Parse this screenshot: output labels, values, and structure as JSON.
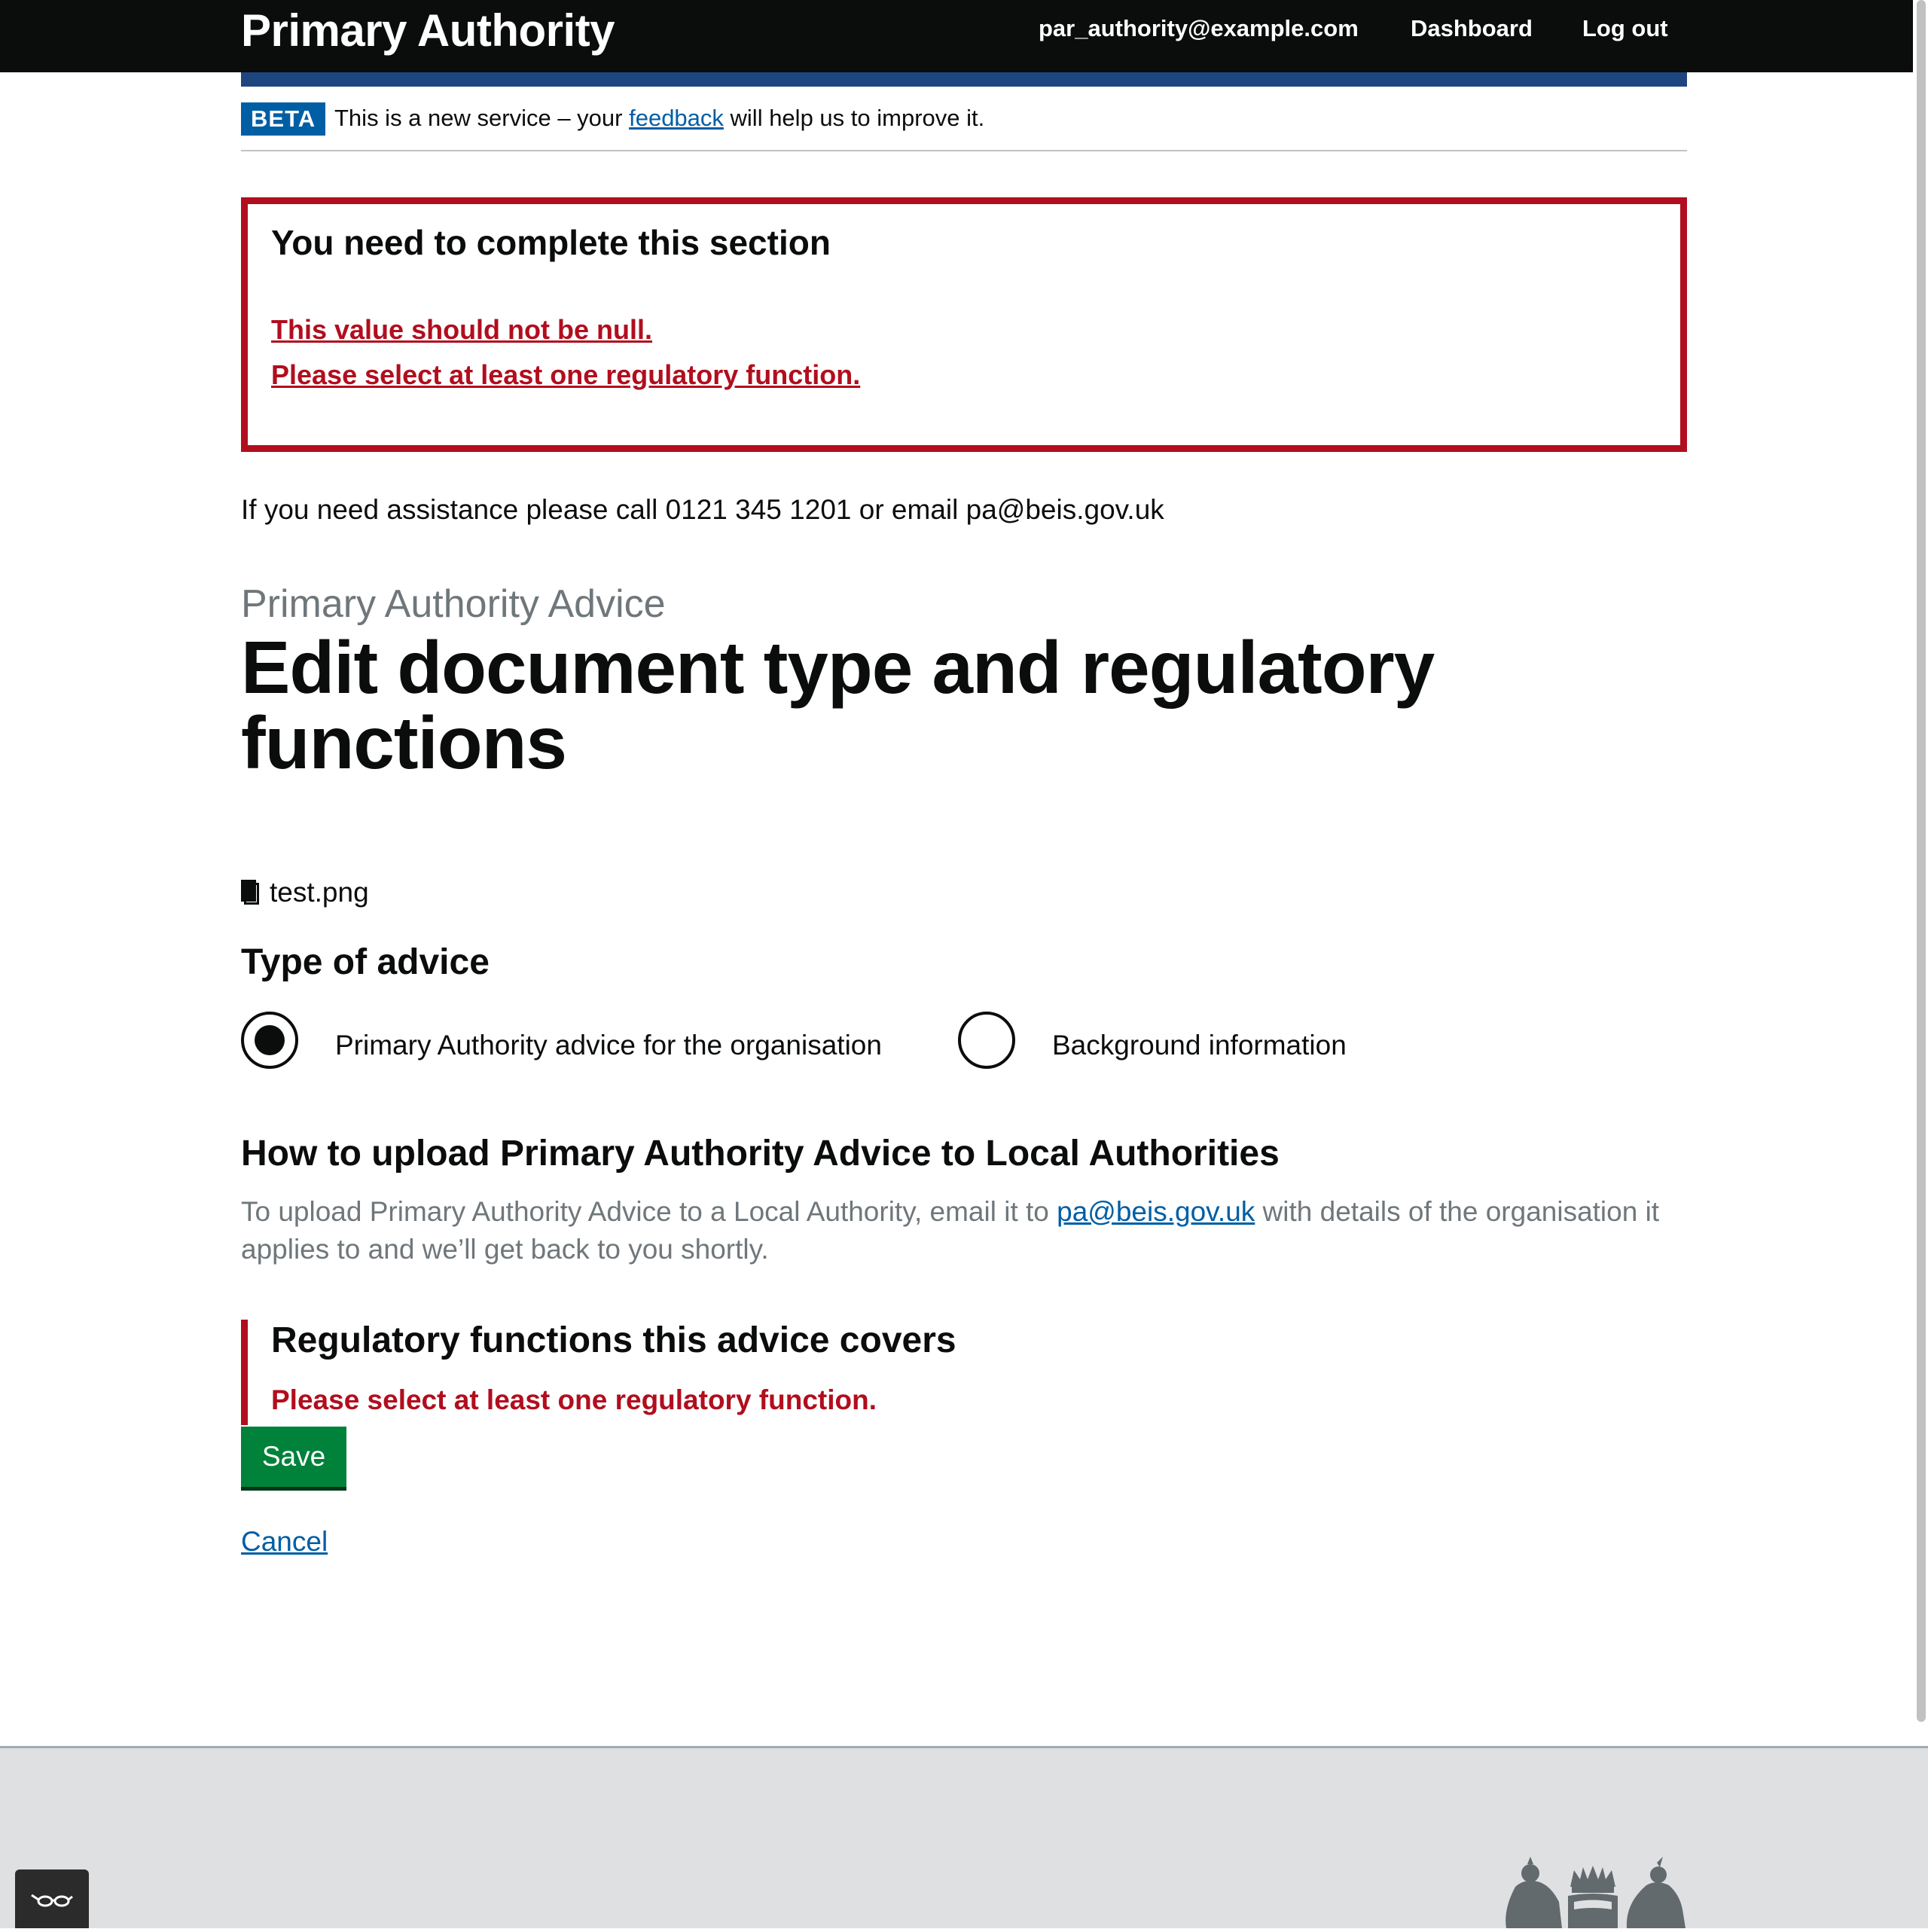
{
  "header": {
    "brand": "Primary Authority",
    "user_email": "par_authority@example.com",
    "dashboard": "Dashboard",
    "logout": "Log out"
  },
  "beta": {
    "tag": "BETA",
    "text_before": "This is a new service – your ",
    "link": "feedback",
    "text_after": " will help us to improve it."
  },
  "error_summary": {
    "title": "You need to complete this section",
    "errors": [
      "This value should not be null.",
      "Please select at least one regulatory function."
    ]
  },
  "assistance": "If you need assistance please call 0121 345 1201 or email pa@beis.gov.uk",
  "page": {
    "caption": "Primary Authority Advice",
    "title": "Edit document type and regulatory functions"
  },
  "file": {
    "name": "test.png",
    "icon": "document-icon"
  },
  "advice_type": {
    "heading": "Type of advice",
    "options": [
      {
        "label": "Primary Authority advice for the organisation",
        "selected": true
      },
      {
        "label": "Background information",
        "selected": false
      }
    ]
  },
  "upload_help": {
    "heading": "How to upload Primary Authority Advice to Local Authorities",
    "text_before": "To upload Primary Authority Advice to a Local Authority, email it to ",
    "email": "pa@beis.gov.uk",
    "text_after": " with details of the organisation it applies to and we’ll get back to you shortly."
  },
  "regulatory": {
    "heading": "Regulatory functions this advice covers",
    "error": "Please select at least one regulatory function."
  },
  "actions": {
    "save": "Save",
    "cancel": "Cancel"
  },
  "colors": {
    "header_bg": "#0b0c0c",
    "blue_strip": "#1d4580",
    "beta_tag": "#005ea5",
    "error": "#b10e1e",
    "link": "#005ea5",
    "button": "#00823b",
    "secondary_text": "#6f777b",
    "footer_bg": "#dee0e2"
  }
}
